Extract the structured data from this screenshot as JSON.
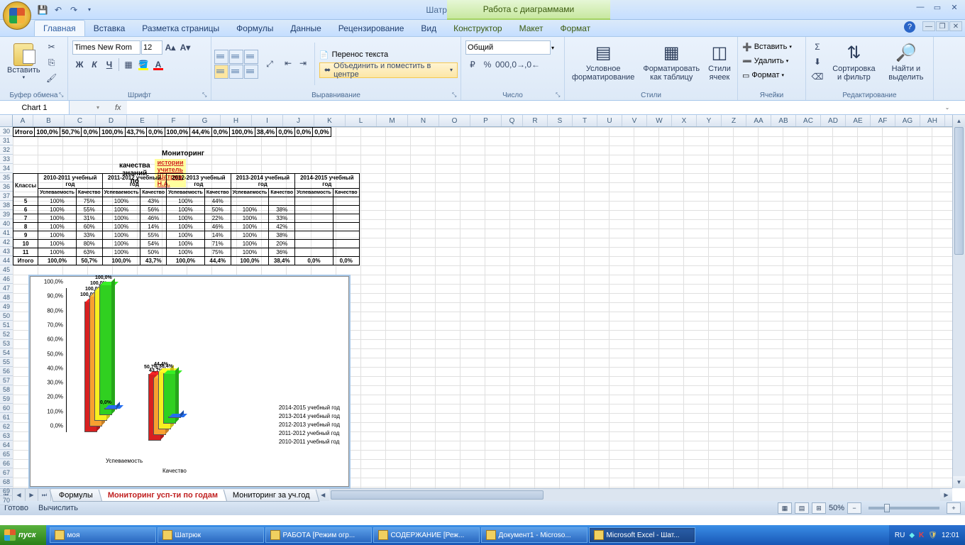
{
  "window": {
    "title": "Шатрюк Н.А - Microsoft Excel",
    "contextual_group": "Работа с диаграммами"
  },
  "tabs": {
    "home": "Главная",
    "insert": "Вставка",
    "page_layout": "Разметка страницы",
    "formulas": "Формулы",
    "data": "Данные",
    "review": "Рецензирование",
    "view": "Вид",
    "design": "Конструктор",
    "layout": "Макет",
    "format": "Формат"
  },
  "ribbon": {
    "clipboard": {
      "label": "Буфер обмена",
      "paste": "Вставить"
    },
    "font": {
      "label": "Шрифт",
      "name": "Times New Rom",
      "size": "12",
      "bold": "Ж",
      "italic": "К",
      "underline": "Ч"
    },
    "alignment": {
      "label": "Выравнивание",
      "wrap": "Перенос текста",
      "merge": "Объединить и поместить в центре"
    },
    "number": {
      "label": "Число",
      "format": "Общий"
    },
    "styles": {
      "label": "Стили",
      "cond": "Условное форматирование",
      "table": "Форматировать как таблицу",
      "cell": "Стили ячеек"
    },
    "cells": {
      "label": "Ячейки",
      "insert": "Вставить",
      "delete": "Удалить",
      "format": "Формат"
    },
    "editing": {
      "label": "Редактирование",
      "sort": "Сортировка и фильтр",
      "find": "Найти и выделить"
    }
  },
  "name_box": "Chart 1",
  "fx": "fx",
  "columns": [
    "A",
    "B",
    "C",
    "D",
    "E",
    "F",
    "G",
    "H",
    "I",
    "J",
    "K",
    "L",
    "M",
    "N",
    "O",
    "P",
    "Q",
    "R",
    "S",
    "T",
    "U",
    "V",
    "W",
    "X",
    "Y",
    "Z",
    "AA",
    "AB",
    "AC",
    "AD",
    "AE",
    "AF",
    "AG",
    "AH"
  ],
  "row_start": 30,
  "row_end": 70,
  "top_total_row": [
    "Итого",
    "100,0%",
    "50,7%",
    "0,0%",
    "100,0%",
    "43,7%",
    "0,0%",
    "100,0%",
    "44,4%",
    "0,0%",
    "100,0%",
    "38,4%",
    "0,0%",
    "0,0%",
    "0,0%"
  ],
  "title1": "Мониторинг",
  "title2": "качества знаний по",
  "subject": "истории учитель Шатрюк Н.А.",
  "table_year_headers": [
    "2010-2011 учебный год",
    "2011-2012 учебный год",
    "2012-2013  учебный год",
    "2013-2014 учебный год",
    "2014-2015 учебный год"
  ],
  "table_sub_headers": [
    "Успеваемость",
    "Качество"
  ],
  "table_class_label": "Классы",
  "table_rows": [
    {
      "cls": "5",
      "v": [
        "100%",
        "75%",
        "100%",
        "43%",
        "100%",
        "44%",
        "",
        "",
        "",
        ""
      ]
    },
    {
      "cls": "6",
      "v": [
        "100%",
        "55%",
        "100%",
        "56%",
        "100%",
        "50%",
        "100%",
        "38%",
        "",
        ""
      ]
    },
    {
      "cls": "7",
      "v": [
        "100%",
        "31%",
        "100%",
        "46%",
        "100%",
        "22%",
        "100%",
        "33%",
        "",
        ""
      ]
    },
    {
      "cls": "8",
      "v": [
        "100%",
        "60%",
        "100%",
        "14%",
        "100%",
        "46%",
        "100%",
        "42%",
        "",
        ""
      ]
    },
    {
      "cls": "9",
      "v": [
        "100%",
        "33%",
        "100%",
        "55%",
        "100%",
        "14%",
        "100%",
        "38%",
        "",
        ""
      ]
    },
    {
      "cls": "10",
      "v": [
        "100%",
        "80%",
        "100%",
        "54%",
        "100%",
        "71%",
        "100%",
        "20%",
        "",
        ""
      ]
    },
    {
      "cls": "11",
      "v": [
        "100%",
        "63%",
        "100%",
        "50%",
        "100%",
        "75%",
        "100%",
        "36%",
        "",
        ""
      ]
    }
  ],
  "table_total": [
    "Итого",
    "100,0%",
    "50,7%",
    "100,0%",
    "43,7%",
    "100,0%",
    "44,4%",
    "100,0%",
    "38,4%",
    "0,0%",
    "0,0%"
  ],
  "chart_data": {
    "type": "bar",
    "categories": [
      "Успеваемость",
      "Качество"
    ],
    "series": [
      {
        "name": "2010-2011 учебный год",
        "values": [
          100.0,
          50.7
        ],
        "color": "#d82020"
      },
      {
        "name": "2011-2012 учебный год",
        "values": [
          100.0,
          43.7
        ],
        "color": "#f8a030"
      },
      {
        "name": "2012-2013 учебный год",
        "values": [
          100.0,
          44.4
        ],
        "color": "#f8f020"
      },
      {
        "name": "2013-2014 учебный год",
        "values": [
          100.0,
          38.4
        ],
        "color": "#30d020"
      },
      {
        "name": "2014-2015 учебный год",
        "values": [
          0.0,
          0.0
        ],
        "color": "#2060d0"
      }
    ],
    "ylabel": "",
    "ylim": [
      0,
      100
    ],
    "ticks": [
      "0,0%",
      "10,0%",
      "20,0%",
      "30,0%",
      "40,0%",
      "50,0%",
      "60,0%",
      "70,0%",
      "80,0%",
      "90,0%",
      "100,0%"
    ],
    "datalabels": {
      "usp": [
        "100,0%",
        "100,0%",
        "100,0%",
        "100,0%",
        "0,0%"
      ],
      "kach": [
        "50,7%",
        "43,7%",
        "44,4%",
        "38,4%",
        "0,0%"
      ]
    }
  },
  "sheets": {
    "nav_tip": "",
    "tabs": [
      "Формулы",
      "Мониторинг усп-ти по годам",
      "Мониторинг за уч.год"
    ],
    "active_index": 1
  },
  "status": {
    "ready": "Готово",
    "calc": "Вычислить",
    "zoom": "50%"
  },
  "taskbar": {
    "start": "пуск",
    "items": [
      {
        "label": "моя",
        "active": false
      },
      {
        "label": "Шатрюк",
        "active": false
      },
      {
        "label": "РАБОТА [Режим огр...",
        "active": false
      },
      {
        "label": "СОДЕРЖАНИЕ [Реж...",
        "active": false
      },
      {
        "label": "Документ1 - Microso...",
        "active": false
      },
      {
        "label": "Microsoft Excel - Шат...",
        "active": true
      }
    ],
    "lang": "RU",
    "clock": "12:01"
  }
}
